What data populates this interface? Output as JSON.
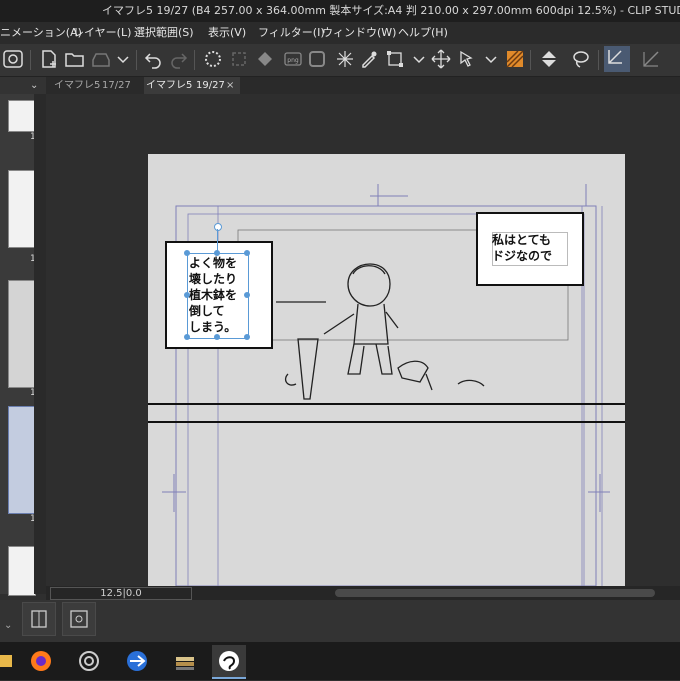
{
  "window": {
    "title": "イマフレ5 19/27 (B4 257.00 x 364.00mm 製本サイズ:A4 判 210.00 x 297.00mm 600dpi 12.5%) - CLIP STUDIO PAINT EX"
  },
  "menu": {
    "items": [
      "ニメーション(A)",
      "レイヤー(L)",
      "選択範囲(S)",
      "表示(V)",
      "フィルター(I)",
      "ウィンドウ(W)",
      "ヘルプ(H)"
    ]
  },
  "tabs": [
    {
      "name": "イマフレ5",
      "page": "17/27"
    },
    {
      "name": "イマフレ5",
      "page": "19/27"
    }
  ],
  "tab_close_glyph": "×",
  "page_panel": {
    "page_number": "1"
  },
  "canvas": {
    "balloon_left_lines": [
      "よく物を",
      "壊したり",
      "植木鉢を",
      "倒して",
      "しまう。"
    ],
    "balloon_right_lines": [
      "私はとても",
      "ドジなので"
    ]
  },
  "status": {
    "zoom": "12.5|0.0"
  },
  "colors": {
    "selection_handle": "#5a9ad6",
    "active_tab": "#3b3b3b",
    "paper": "#d9d9d9"
  },
  "icons": [
    "clip-studio-icon",
    "new-icon",
    "open-icon",
    "save-icon",
    "undo-icon",
    "redo-icon",
    "transform-icon",
    "eyedropper-icon",
    "move-icon",
    "fill-icon",
    "lasso-icon",
    "firefox-icon",
    "csp-launcher-icon",
    "arrow-app-icon",
    "books-icon",
    "csp-paint-icon"
  ]
}
